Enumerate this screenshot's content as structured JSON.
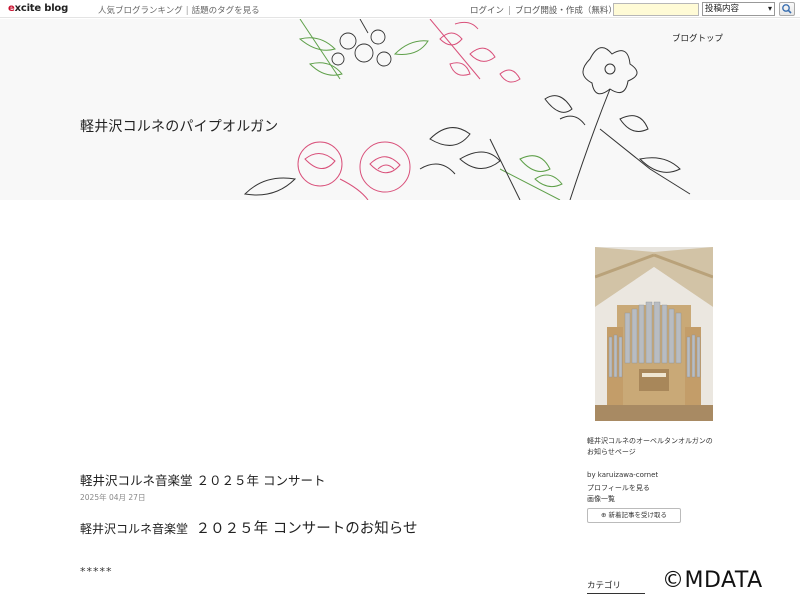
{
  "topbar": {
    "logo_prefix": "e",
    "logo_rest": "xcite blog",
    "ranking_link": "人気ブログランキング",
    "separator": "|",
    "tags_link": "話題のタグを見る",
    "login_link": "ログイン",
    "create_link": "ブログ開設・作成（無料）",
    "search_placeholder": "",
    "search_scope": "投稿内容"
  },
  "header": {
    "blog_title": "軽井沢コルネのパイプオルガン",
    "blog_top_link": "ブログトップ"
  },
  "post": {
    "title": "軽井沢コルネ音楽堂 ２０２５年 コンサート",
    "date": "2025年 04月 27日",
    "lead_small": "軽井沢コルネ音楽堂",
    "lead_big": "２０２５年 コンサートのお知らせ",
    "stars": "*****"
  },
  "sidebar": {
    "description": "軽井沢コルネのオーベルタンオルガンのお知らせページ",
    "by_line": "by karuizawa-cornet",
    "profile_link": "プロフィールを見る",
    "image_list_link": "画像一覧",
    "subscribe_button": "新着記事を受け取る",
    "category_title": "カテゴリ"
  },
  "watermark": "©MDATA",
  "colors": {
    "header_bg": "#f8f8f8",
    "logo_accent": "#c8102e",
    "search_bg": "#fffbd6",
    "flower_pink": "#d9507a",
    "leaf_green": "#5fa04a"
  }
}
